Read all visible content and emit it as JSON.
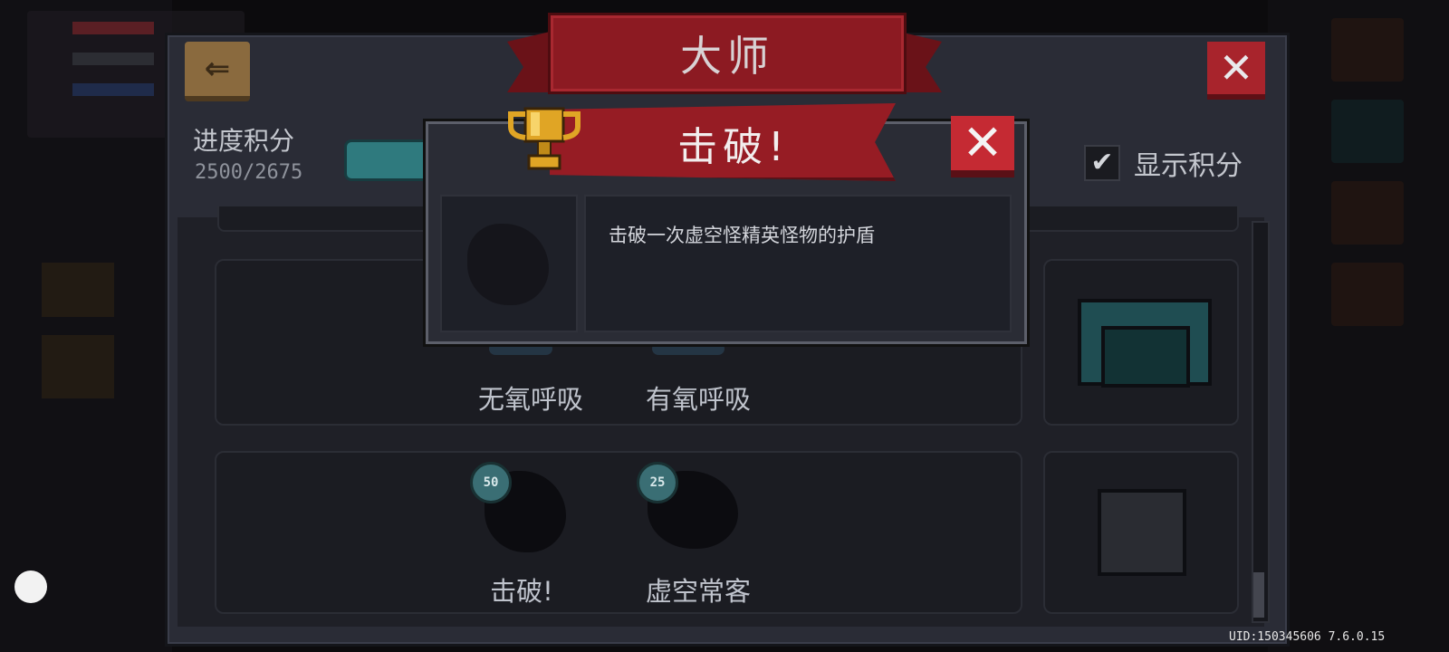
{
  "screen_title": "大师",
  "progress": {
    "label": "进度积分",
    "value_text": "2500/2675",
    "current": 2500,
    "total": 2675
  },
  "show_score": {
    "label": "显示积分",
    "checked": true,
    "check_glyph": "✔"
  },
  "icons": {
    "back": "back-icon",
    "close": "close-icon",
    "trophy": "trophy-icon",
    "close_glyph": "✕",
    "back_glyph": "⇐"
  },
  "popup": {
    "title": "击破!",
    "description": "击破一次虚空怪精英怪物的护盾"
  },
  "achievements": {
    "row1": [
      {
        "name": "无氧呼吸"
      },
      {
        "name": "有氧呼吸"
      }
    ],
    "row2": [
      {
        "name": "击破!",
        "points": "50"
      },
      {
        "name": "虚空常客",
        "points": "25"
      }
    ]
  },
  "footer": {
    "uid": "UID:150345606 7.6.0.15"
  },
  "colors": {
    "panel": "#2a2c36",
    "banner_red": "#8c1a22",
    "close_red": "#c52a33",
    "teal": "#2f7a7e"
  }
}
